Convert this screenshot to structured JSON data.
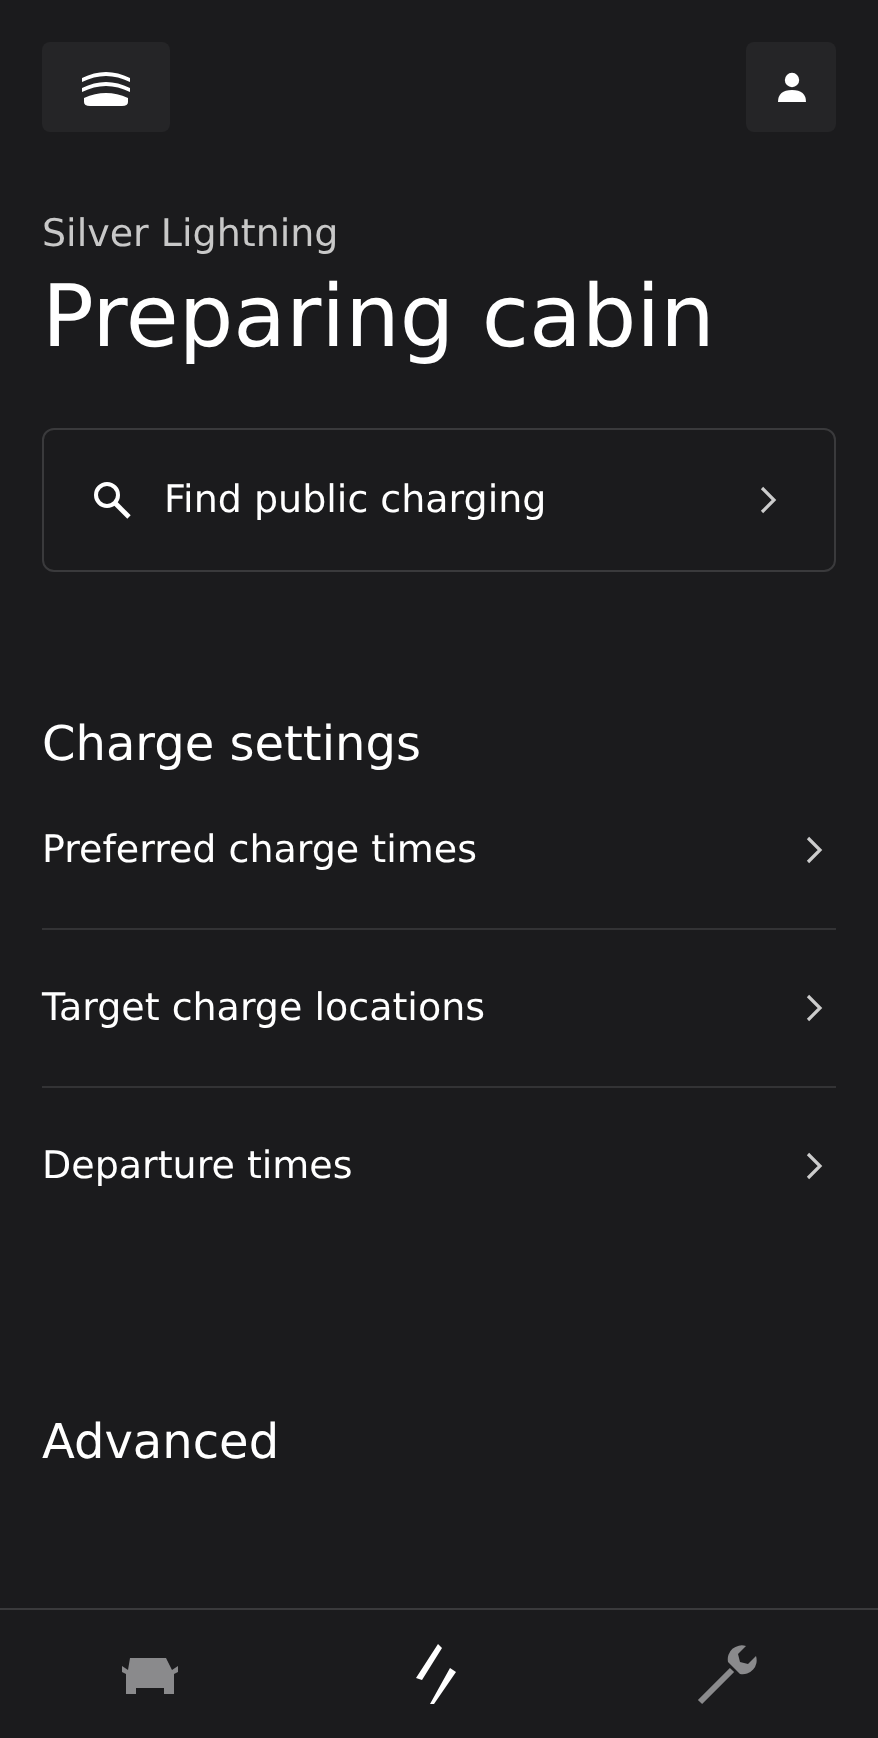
{
  "header": {
    "subtitle": "Silver Lightning",
    "title": "Preparing cabin"
  },
  "search": {
    "label": "Find public charging"
  },
  "sections": [
    {
      "title": "Charge settings",
      "items": [
        {
          "label": "Preferred charge times"
        },
        {
          "label": "Target charge locations"
        },
        {
          "label": "Departure times"
        }
      ]
    },
    {
      "title": "Advanced"
    }
  ],
  "nav": [
    {
      "kind": "car",
      "selected": false
    },
    {
      "kind": "charge",
      "selected": true
    },
    {
      "kind": "service",
      "selected": false
    }
  ]
}
